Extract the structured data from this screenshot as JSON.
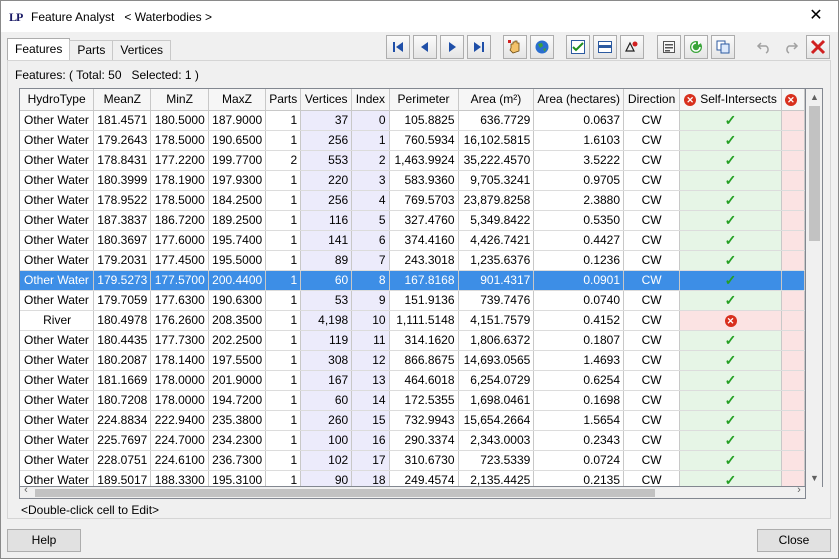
{
  "window": {
    "app_icon_text": "LP",
    "title": "Feature Analyst   < Waterbodies >",
    "close_glyph": "✕"
  },
  "tabs": [
    {
      "label": "Features",
      "active": true
    },
    {
      "label": "Parts",
      "active": false
    },
    {
      "label": "Vertices",
      "active": false
    }
  ],
  "toolbar": {
    "buttons": [
      {
        "icon": "first-record-icon",
        "enabled": true
      },
      {
        "icon": "previous-record-icon",
        "enabled": true
      },
      {
        "icon": "next-record-icon",
        "enabled": true
      },
      {
        "icon": "last-record-icon",
        "enabled": true
      },
      {
        "icon": "pan-to-feature-icon",
        "enabled": true
      },
      {
        "icon": "globe-icon",
        "enabled": true
      },
      {
        "icon": "check-all-icon",
        "enabled": true
      },
      {
        "icon": "table-view-icon",
        "enabled": true
      },
      {
        "icon": "select-features-icon",
        "enabled": true
      },
      {
        "icon": "properties-icon",
        "enabled": true
      },
      {
        "icon": "refresh-icon",
        "enabled": true
      },
      {
        "icon": "copy-icon",
        "enabled": true
      },
      {
        "icon": "undo-icon",
        "enabled": false
      },
      {
        "icon": "redo-icon",
        "enabled": false
      },
      {
        "icon": "delete-icon",
        "enabled": true
      }
    ]
  },
  "summary": "Features: ( Total: 50   Selected: 1 )",
  "grid": {
    "columns": [
      "HydroType",
      "MeanZ",
      "MinZ",
      "MaxZ",
      "Parts",
      "Vertices",
      "Index",
      "Perimeter",
      "Area (m²)",
      "Area (hectares)",
      "Direction",
      "Self-Intersects",
      ""
    ],
    "rows": [
      {
        "hydro": "Other Water",
        "meanz": "181.4571",
        "minz": "180.5000",
        "maxz": "187.9000",
        "parts": "1",
        "vertices": "37",
        "index": "0",
        "perimeter": "105.8825",
        "area_m2": "636.7729",
        "area_ha": "0.0637",
        "direction": "CW",
        "self_intersects": "ok",
        "selected": false
      },
      {
        "hydro": "Other Water",
        "meanz": "179.2643",
        "minz": "178.5000",
        "maxz": "190.6500",
        "parts": "1",
        "vertices": "256",
        "index": "1",
        "perimeter": "760.5934",
        "area_m2": "16,102.5815",
        "area_ha": "1.6103",
        "direction": "CW",
        "self_intersects": "ok",
        "selected": false
      },
      {
        "hydro": "Other Water",
        "meanz": "178.8431",
        "minz": "177.2200",
        "maxz": "199.7700",
        "parts": "2",
        "vertices": "553",
        "index": "2",
        "perimeter": "1,463.9924",
        "area_m2": "35,222.4570",
        "area_ha": "3.5222",
        "direction": "CW",
        "self_intersects": "ok",
        "selected": false
      },
      {
        "hydro": "Other Water",
        "meanz": "180.3999",
        "minz": "178.1900",
        "maxz": "197.9300",
        "parts": "1",
        "vertices": "220",
        "index": "3",
        "perimeter": "583.9360",
        "area_m2": "9,705.3241",
        "area_ha": "0.9705",
        "direction": "CW",
        "self_intersects": "ok",
        "selected": false
      },
      {
        "hydro": "Other Water",
        "meanz": "178.9522",
        "minz": "178.5000",
        "maxz": "184.2500",
        "parts": "1",
        "vertices": "256",
        "index": "4",
        "perimeter": "769.5703",
        "area_m2": "23,879.8258",
        "area_ha": "2.3880",
        "direction": "CW",
        "self_intersects": "ok",
        "selected": false
      },
      {
        "hydro": "Other Water",
        "meanz": "187.3837",
        "minz": "186.7200",
        "maxz": "189.2500",
        "parts": "1",
        "vertices": "116",
        "index": "5",
        "perimeter": "327.4760",
        "area_m2": "5,349.8422",
        "area_ha": "0.5350",
        "direction": "CW",
        "self_intersects": "ok",
        "selected": false
      },
      {
        "hydro": "Other Water",
        "meanz": "180.3697",
        "minz": "177.6000",
        "maxz": "195.7400",
        "parts": "1",
        "vertices": "141",
        "index": "6",
        "perimeter": "374.4160",
        "area_m2": "4,426.7421",
        "area_ha": "0.4427",
        "direction": "CW",
        "self_intersects": "ok",
        "selected": false
      },
      {
        "hydro": "Other Water",
        "meanz": "179.2031",
        "minz": "177.4500",
        "maxz": "195.5000",
        "parts": "1",
        "vertices": "89",
        "index": "7",
        "perimeter": "243.3018",
        "area_m2": "1,235.6376",
        "area_ha": "0.1236",
        "direction": "CW",
        "self_intersects": "ok",
        "selected": false
      },
      {
        "hydro": "Other Water",
        "meanz": "179.5273",
        "minz": "177.5700",
        "maxz": "200.4400",
        "parts": "1",
        "vertices": "60",
        "index": "8",
        "perimeter": "167.8168",
        "area_m2": "901.4317",
        "area_ha": "0.0901",
        "direction": "CW",
        "self_intersects": "ok",
        "selected": true
      },
      {
        "hydro": "Other Water",
        "meanz": "179.7059",
        "minz": "177.6300",
        "maxz": "190.6300",
        "parts": "1",
        "vertices": "53",
        "index": "9",
        "perimeter": "151.9136",
        "area_m2": "739.7476",
        "area_ha": "0.0740",
        "direction": "CW",
        "self_intersects": "ok",
        "selected": false
      },
      {
        "hydro": "River",
        "meanz": "180.4978",
        "minz": "176.2600",
        "maxz": "208.3500",
        "parts": "1",
        "vertices": "4,198",
        "index": "10",
        "perimeter": "1,111.5148",
        "area_m2": "4,151.7579",
        "area_ha": "0.4152",
        "direction": "CW",
        "self_intersects": "bad",
        "selected": false
      },
      {
        "hydro": "Other Water",
        "meanz": "180.4435",
        "minz": "177.7300",
        "maxz": "202.2500",
        "parts": "1",
        "vertices": "119",
        "index": "11",
        "perimeter": "314.1620",
        "area_m2": "1,806.6372",
        "area_ha": "0.1807",
        "direction": "CW",
        "self_intersects": "ok",
        "selected": false
      },
      {
        "hydro": "Other Water",
        "meanz": "180.2087",
        "minz": "178.1400",
        "maxz": "197.5500",
        "parts": "1",
        "vertices": "308",
        "index": "12",
        "perimeter": "866.8675",
        "area_m2": "14,693.0565",
        "area_ha": "1.4693",
        "direction": "CW",
        "self_intersects": "ok",
        "selected": false
      },
      {
        "hydro": "Other Water",
        "meanz": "181.1669",
        "minz": "178.0000",
        "maxz": "201.9000",
        "parts": "1",
        "vertices": "167",
        "index": "13",
        "perimeter": "464.6018",
        "area_m2": "6,254.0729",
        "area_ha": "0.6254",
        "direction": "CW",
        "self_intersects": "ok",
        "selected": false
      },
      {
        "hydro": "Other Water",
        "meanz": "180.7208",
        "minz": "178.0000",
        "maxz": "194.7200",
        "parts": "1",
        "vertices": "60",
        "index": "14",
        "perimeter": "172.5355",
        "area_m2": "1,698.0461",
        "area_ha": "0.1698",
        "direction": "CW",
        "self_intersects": "ok",
        "selected": false
      },
      {
        "hydro": "Other Water",
        "meanz": "224.8834",
        "minz": "222.9400",
        "maxz": "235.3800",
        "parts": "1",
        "vertices": "260",
        "index": "15",
        "perimeter": "732.9943",
        "area_m2": "15,654.2664",
        "area_ha": "1.5654",
        "direction": "CW",
        "self_intersects": "ok",
        "selected": false
      },
      {
        "hydro": "Other Water",
        "meanz": "225.7697",
        "minz": "224.7000",
        "maxz": "234.2300",
        "parts": "1",
        "vertices": "100",
        "index": "16",
        "perimeter": "290.3374",
        "area_m2": "2,343.0003",
        "area_ha": "0.2343",
        "direction": "CW",
        "self_intersects": "ok",
        "selected": false
      },
      {
        "hydro": "Other Water",
        "meanz": "228.0751",
        "minz": "224.6100",
        "maxz": "236.7300",
        "parts": "1",
        "vertices": "102",
        "index": "17",
        "perimeter": "310.6730",
        "area_m2": "723.5339",
        "area_ha": "0.0724",
        "direction": "CW",
        "self_intersects": "ok",
        "selected": false
      },
      {
        "hydro": "Other Water",
        "meanz": "189.5017",
        "minz": "188.3300",
        "maxz": "195.3100",
        "parts": "1",
        "vertices": "90",
        "index": "18",
        "perimeter": "249.4574",
        "area_m2": "2,135.4425",
        "area_ha": "0.2135",
        "direction": "CW",
        "self_intersects": "ok",
        "selected": false
      }
    ]
  },
  "hint": "<Double-click cell to Edit>",
  "footer": {
    "help_label": "Help",
    "close_label": "Close"
  },
  "colors": {
    "selected_row": "#3d8ee6",
    "ok_cell": "#e6f5e6",
    "bad_cell": "#fbe3e3",
    "vertices_cell": "#ecebfb"
  }
}
